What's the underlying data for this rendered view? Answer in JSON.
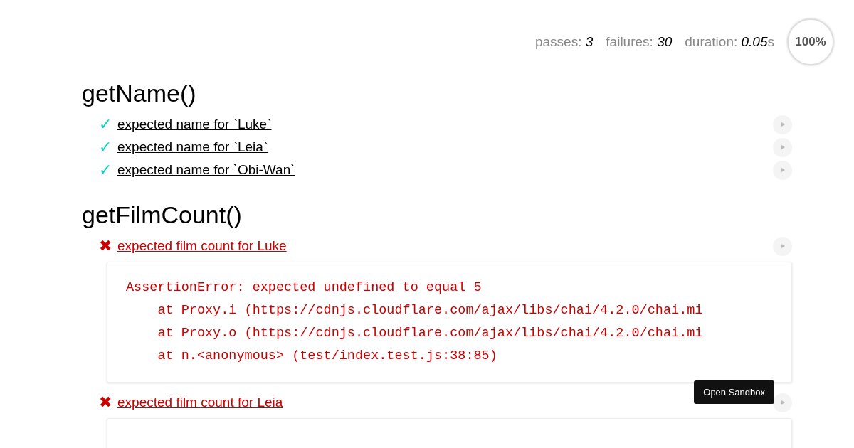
{
  "stats": {
    "items": [
      {
        "label": "passes:",
        "value": "3"
      },
      {
        "label": "failures:",
        "value": "30"
      },
      {
        "label": "duration:",
        "value": "0.05",
        "unit": "s"
      }
    ],
    "progress": "100%"
  },
  "suites": [
    {
      "title": "getName()",
      "tests": [
        {
          "kind": "pass",
          "mark": "✓",
          "title": "expected name for `Luke`"
        },
        {
          "kind": "pass",
          "mark": "✓",
          "title": "expected name for `Leia`"
        },
        {
          "kind": "pass",
          "mark": "✓",
          "title": "expected name for `Obi-Wan`"
        }
      ]
    },
    {
      "title": "getFilmCount()",
      "tests": [
        {
          "kind": "fail",
          "mark": "✖",
          "title": "expected film count for Luke",
          "expanded": true,
          "error": [
            "AssertionError: expected undefined to equal 5",
            "    at Proxy.i (https://cdnjs.cloudflare.com/ajax/libs/chai/4.2.0/chai.mi",
            "    at Proxy.o (https://cdnjs.cloudflare.com/ajax/libs/chai/4.2.0/chai.mi",
            "    at n.<anonymous> (test/index.test.js:38:85)"
          ],
          "tooltip": "Open Sandbox"
        },
        {
          "kind": "fail",
          "mark": "✖",
          "title": "expected film count for Leia",
          "expanded": true
        }
      ]
    }
  ]
}
